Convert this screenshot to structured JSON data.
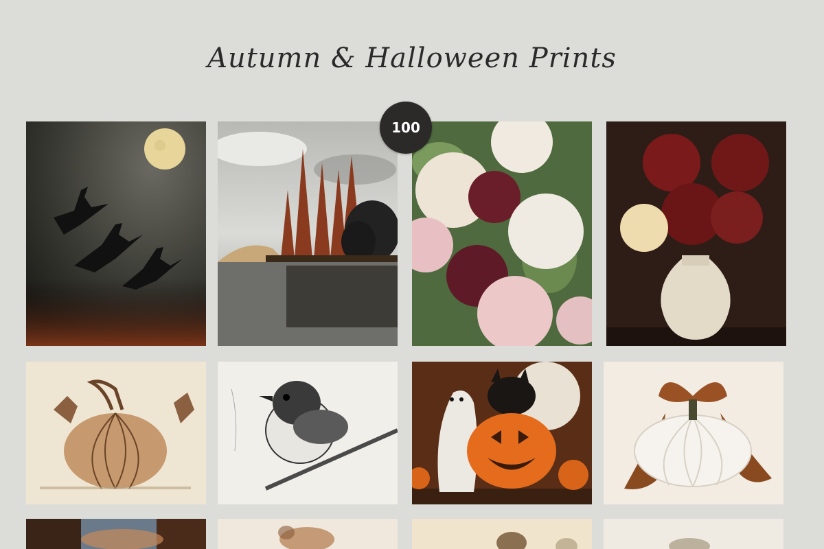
{
  "header": {
    "title": "Autumn & Halloween Prints"
  },
  "badge": {
    "count": "100"
  },
  "prints": [
    {
      "name": "witches-flying-moon"
    },
    {
      "name": "autumn-trees-lake"
    },
    {
      "name": "pink-burgundy-roses"
    },
    {
      "name": "red-ranunculus-vase"
    },
    {
      "name": "vintage-pumpkin-sketch"
    },
    {
      "name": "bird-on-branch-sketch"
    },
    {
      "name": "ghost-black-cat-jack-o-lantern"
    },
    {
      "name": "white-pumpkin-brown-bow"
    },
    {
      "name": "autumn-forest-sunset"
    },
    {
      "name": "dried-flowers-sketch"
    },
    {
      "name": "bird-vintage-print"
    },
    {
      "name": "dried-botanical-print"
    }
  ]
}
